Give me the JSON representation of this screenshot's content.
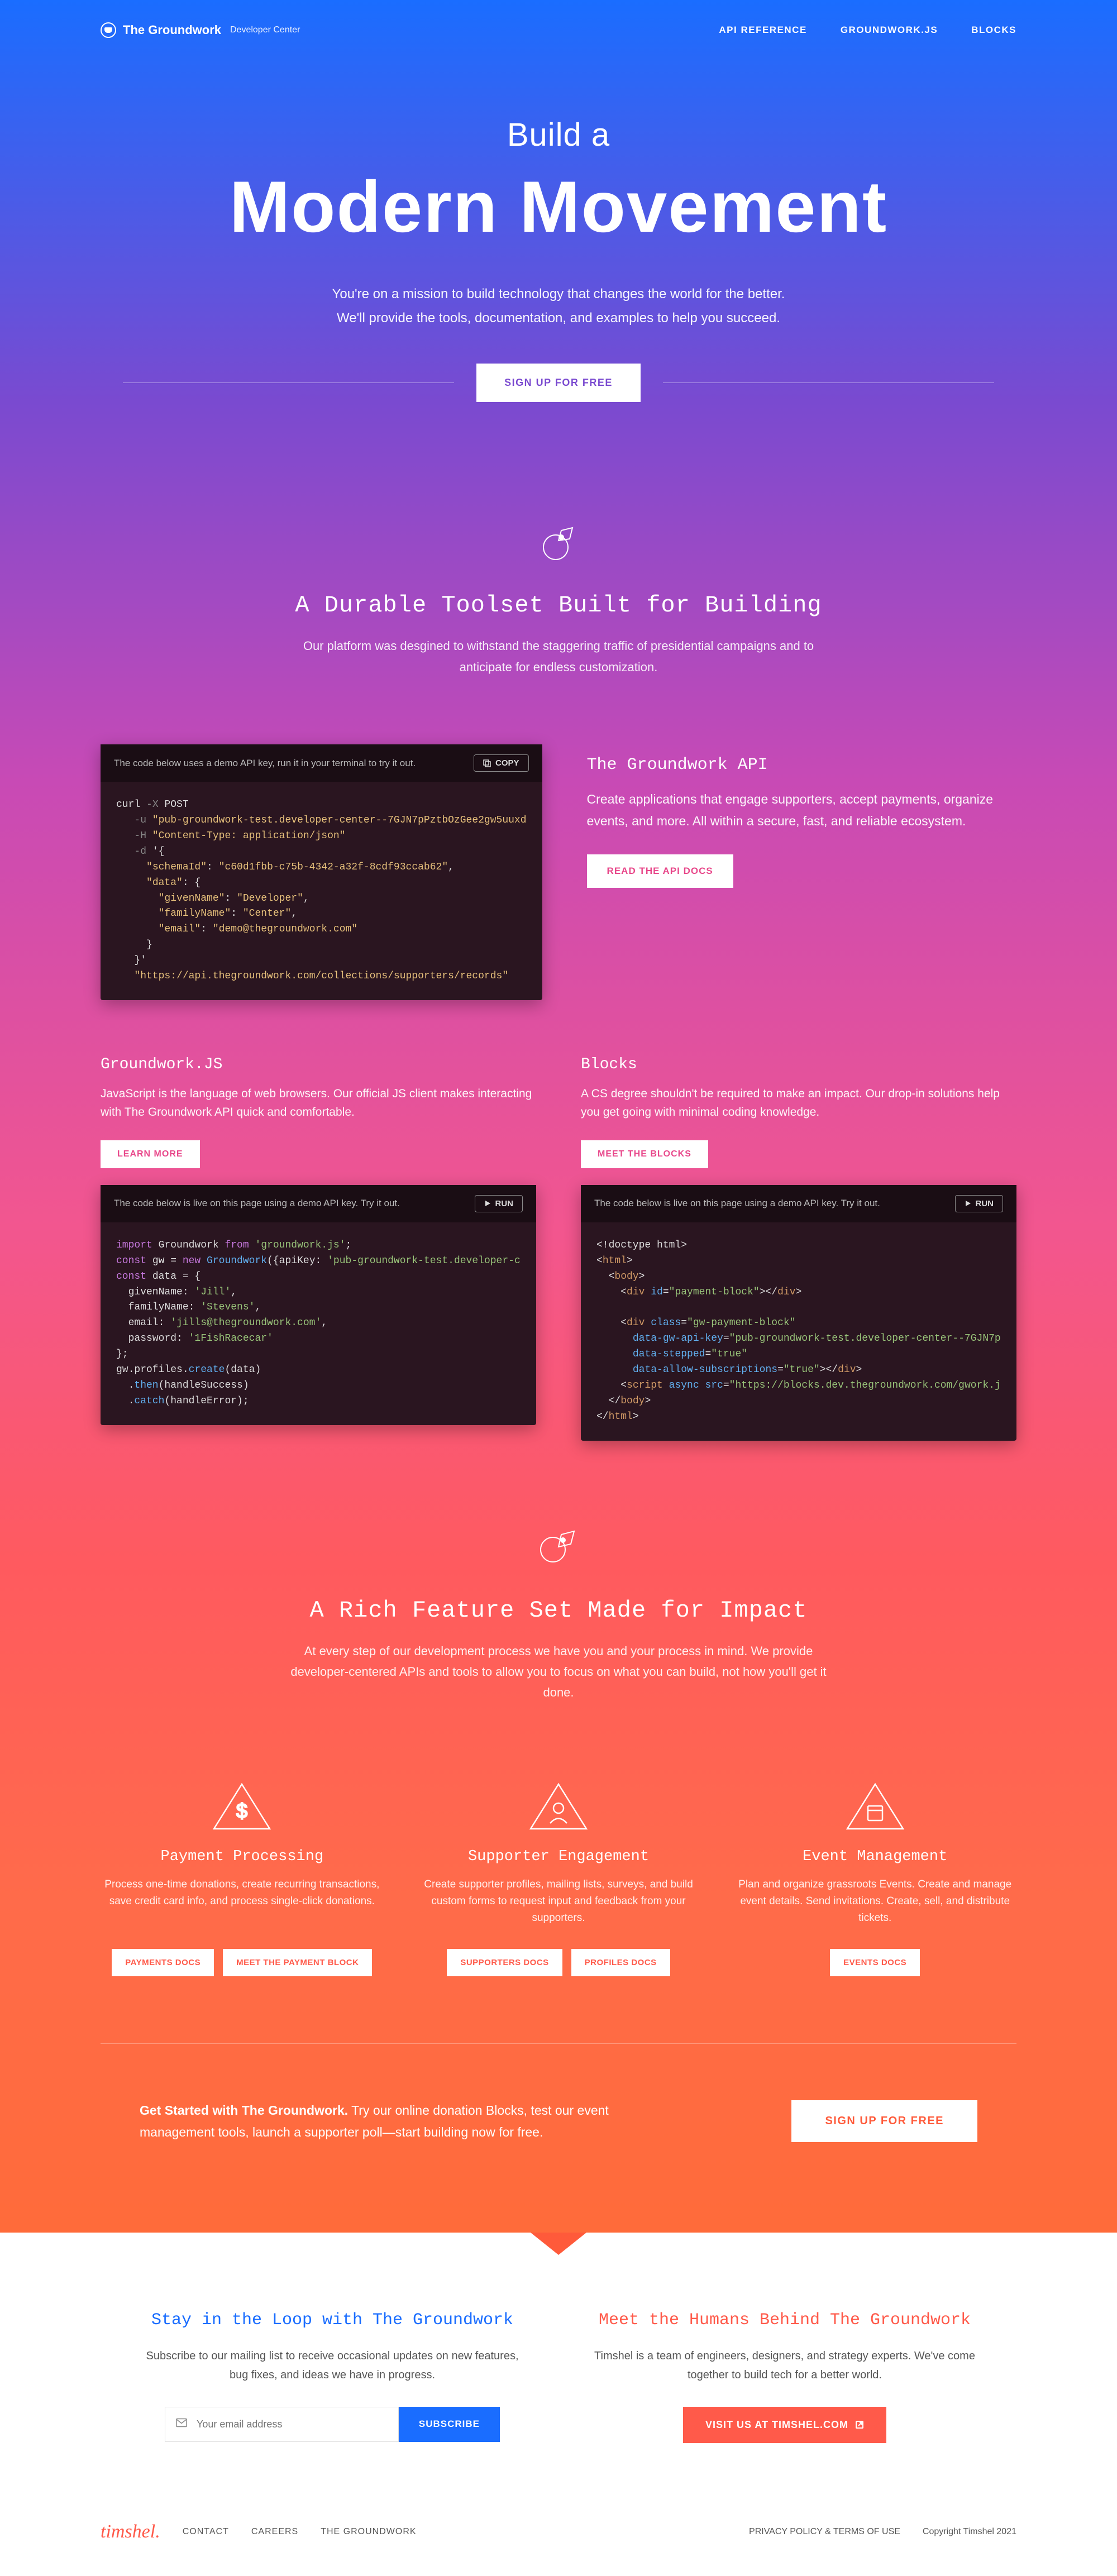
{
  "nav": {
    "brand": "The Groundwork",
    "brand_sub": "Developer Center",
    "links": [
      "API REFERENCE",
      "GROUNDWORK.JS",
      "BLOCKS"
    ]
  },
  "hero": {
    "small": "Build a",
    "big": "Modern Movement",
    "desc1": "You're on a mission to build technology that changes the world for the better.",
    "desc2": "We'll provide the tools, documentation, and examples to help you succeed.",
    "cta": "SIGN UP FOR FREE"
  },
  "toolset": {
    "title": "A Durable Toolset Built for Building",
    "desc": "Our platform was desgined to withstand the staggering traffic of presidential campaigns and to anticipate for endless customization."
  },
  "api": {
    "code_header": "The code below uses a demo API key, run it in your terminal to try it out.",
    "copy_btn": "COPY",
    "title": "The Groundwork API",
    "desc": "Create applications that engage supporters, accept payments, organize events, and more. All within a secure, fast, and reliable ecosystem.",
    "btn": "READ THE API DOCS"
  },
  "gwjs": {
    "title": "Groundwork.JS",
    "desc": "JavaScript is the language of web browsers. Our official JS client makes interacting with The Groundwork API quick and comfortable.",
    "btn": "LEARN MORE",
    "code_header": "The code below is live on this page using a demo API key. Try it out.",
    "run_btn": "RUN"
  },
  "blocks": {
    "title": "Blocks",
    "desc": "A CS degree shouldn't be required to make an impact. Our drop-in solutions help you get going with minimal coding knowledge.",
    "btn": "MEET THE BLOCKS",
    "code_header": "The code below is live on this page using a demo API key. Try it out.",
    "run_btn": "RUN"
  },
  "features": {
    "title": "A Rich Feature Set Made for Impact",
    "desc": "At every step of our development process we have you and your process in mind. We provide developer-centered APIs and tools to allow you to focus on what you can build, not how you'll get it done.",
    "items": [
      {
        "title": "Payment Processing",
        "desc": "Process one-time donations, create recurring transactions, save credit card info, and process single-click donations.",
        "btns": [
          "PAYMENTS DOCS",
          "MEET THE PAYMENT BLOCK"
        ]
      },
      {
        "title": "Supporter Engagement",
        "desc": "Create supporter profiles, mailing lists, surveys, and build custom forms to request input and feedback from your supporters.",
        "btns": [
          "SUPPORTERS DOCS",
          "PROFILES DOCS"
        ]
      },
      {
        "title": "Event Management",
        "desc": "Plan and organize grassroots Events. Create and manage event details. Send invitations. Create, sell, and distribute tickets.",
        "btns": [
          "EVENTS DOCS"
        ]
      }
    ]
  },
  "cta": {
    "bold": "Get Started with The Groundwork.",
    "rest": " Try our online donation Blocks, test our event management tools, launch a supporter poll—start building now for free.",
    "btn": "SIGN UP FOR FREE"
  },
  "footer": {
    "loop_title": "Stay in the Loop with The Groundwork",
    "loop_desc": "Subscribe to our mailing list to receive occasional updates on new features, bug fixes, and ideas we have in progress.",
    "email_placeholder": "Your email address",
    "subscribe_btn": "SUBSCRIBE",
    "humans_title": "Meet the Humans Behind The Groundwork",
    "humans_desc": "Timshel is a team of engineers, designers, and strategy experts. We've come together to build tech for a better world.",
    "visit_btn": "VISIT US AT TIMSHEL.COM"
  },
  "bottom": {
    "logo": "timshel.",
    "links": [
      "CONTACT",
      "CAREERS",
      "THE GROUNDWORK"
    ],
    "right_link": "PRIVACY POLICY & TERMS OF USE",
    "copyright": "Copyright Timshel 2021"
  }
}
